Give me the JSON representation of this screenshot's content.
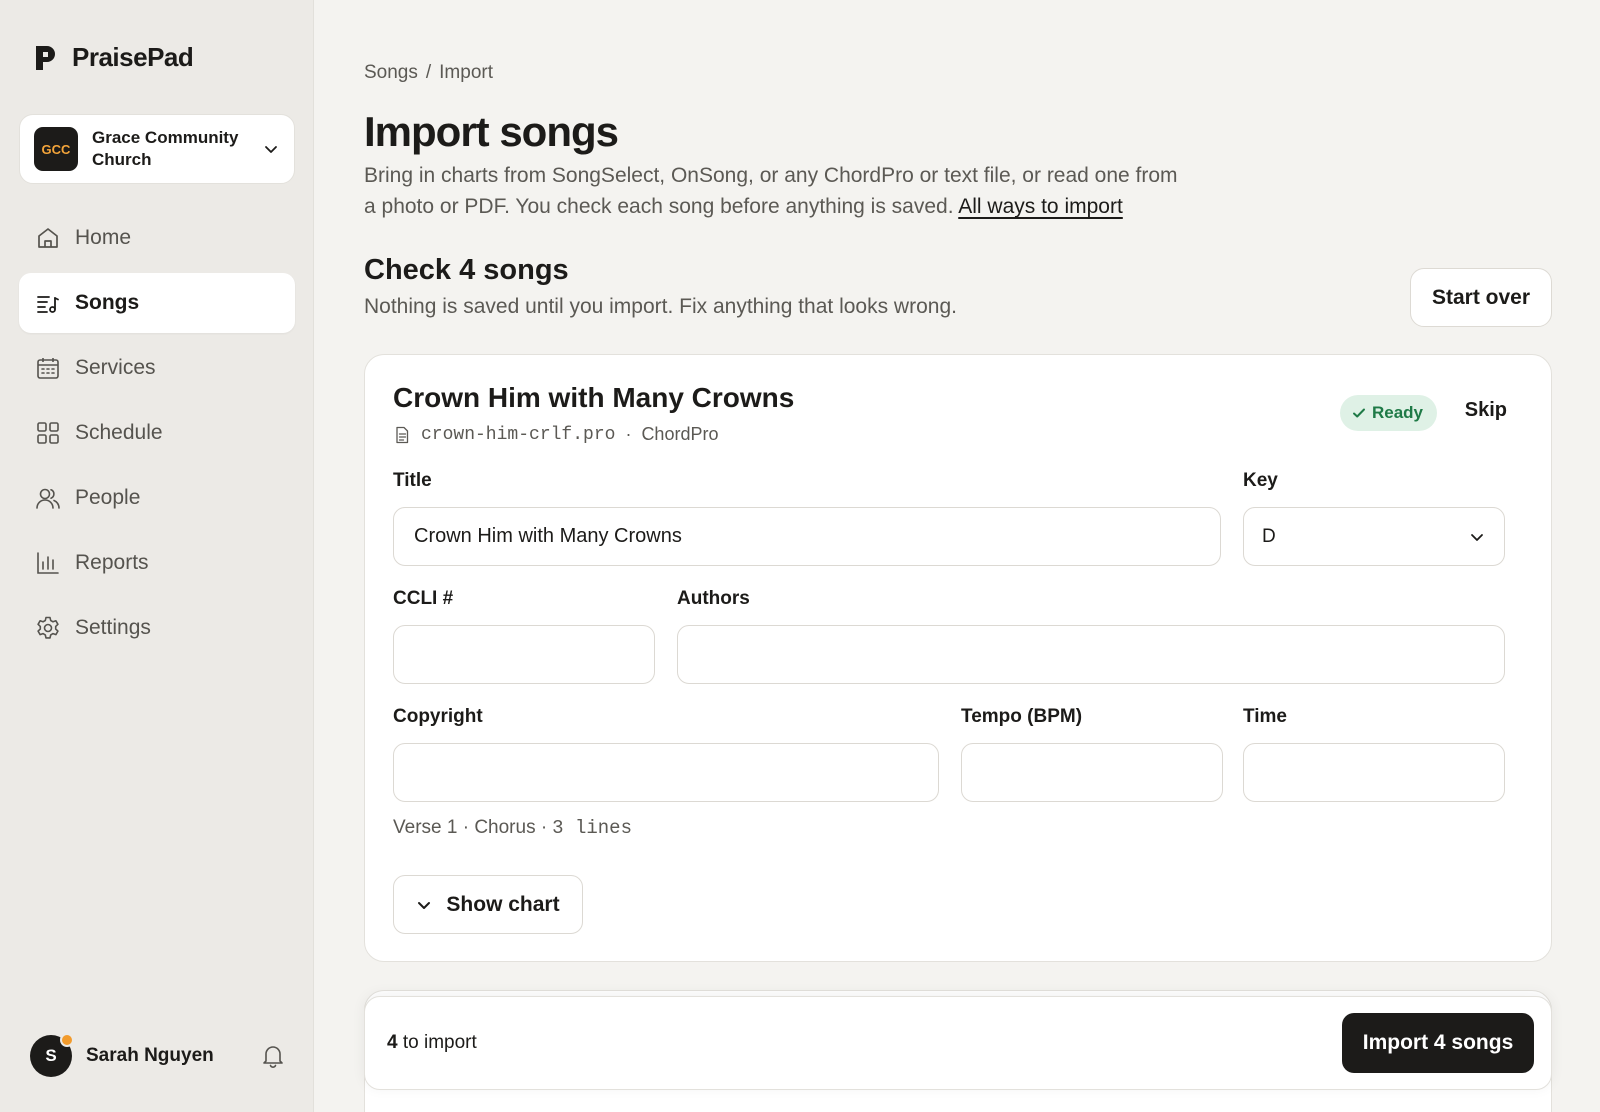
{
  "app": {
    "name": "PraisePad"
  },
  "org": {
    "initials": "GCC",
    "name": "Grace Community Church"
  },
  "nav": [
    {
      "label": "Home",
      "icon": "home-icon"
    },
    {
      "label": "Songs",
      "icon": "songs-icon",
      "active": true
    },
    {
      "label": "Services",
      "icon": "calendar-icon"
    },
    {
      "label": "Schedule",
      "icon": "grid-icon"
    },
    {
      "label": "People",
      "icon": "people-icon"
    },
    {
      "label": "Reports",
      "icon": "bar-chart-icon"
    },
    {
      "label": "Settings",
      "icon": "gear-icon"
    }
  ],
  "user": {
    "initial": "S",
    "name": "Sarah Nguyen"
  },
  "breadcrumb": {
    "parent": "Songs",
    "separator": "/",
    "current": "Import"
  },
  "page": {
    "title": "Import songs",
    "intro": "Bring in charts from SongSelect, OnSong, or any ChordPro or text file, or read one from a photo or PDF. You check each song before anything is saved.",
    "intro_link": "All ways to import"
  },
  "review": {
    "title": "Check 4 songs",
    "subtitle": "Nothing is saved until you import. Fix anything that looks wrong.",
    "start_over": "Start over"
  },
  "song": {
    "title": "Crown Him with Many Crowns",
    "filename": "crown-him-crlf.pro",
    "separator": "·",
    "format": "ChordPro",
    "status": "Ready",
    "skip": "Skip",
    "fields": {
      "title_label": "Title",
      "title_value": "Crown Him with Many Crowns",
      "key_label": "Key",
      "key_value": "D",
      "ccli_label": "CCLI #",
      "ccli_value": "",
      "authors_label": "Authors",
      "authors_value": "",
      "copyright_label": "Copyright",
      "copyright_value": "",
      "tempo_label": "Tempo (BPM)",
      "tempo_value": "",
      "time_label": "Time",
      "time_value": ""
    },
    "sections": "Verse 1 · Chorus ·",
    "lines": "3 lines",
    "show_chart": "Show chart"
  },
  "footer": {
    "count": "4",
    "count_suffix": "to import",
    "import_button": "Import 4 songs"
  },
  "colors": {
    "accent": "#1c1b19",
    "ready_bg": "#dff1e6",
    "ready_text": "#1f7a47",
    "badge_text": "#f4a53a",
    "notification_dot": "#f29b2c"
  }
}
